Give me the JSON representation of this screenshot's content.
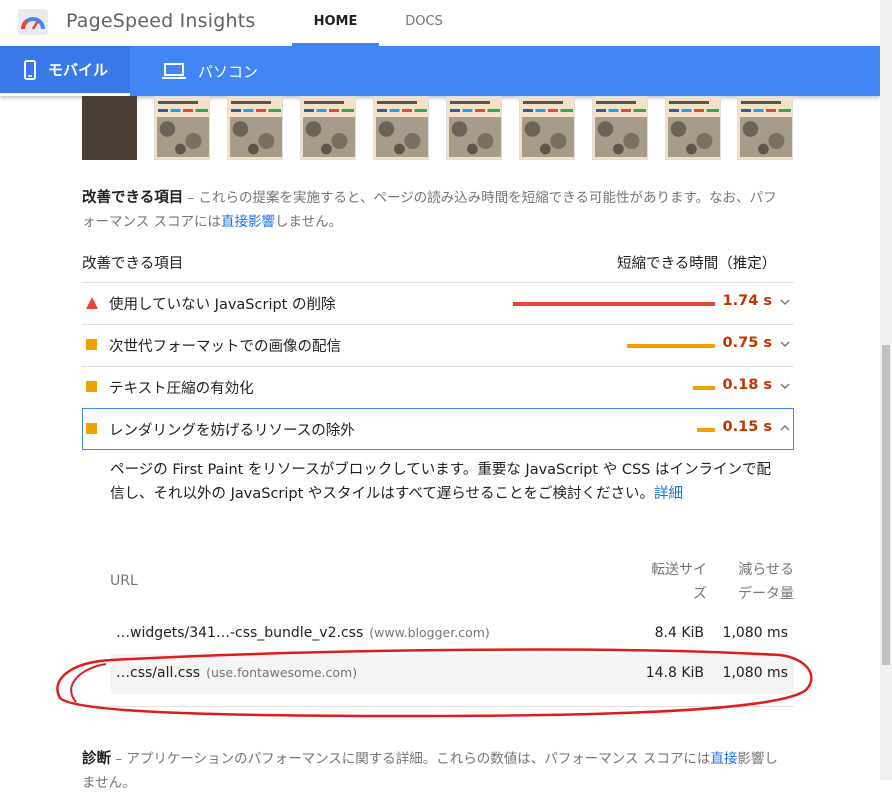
{
  "header": {
    "app_title": "PageSpeed Insights",
    "tab_home": "HOME",
    "tab_docs": "DOCS"
  },
  "devices": {
    "mobile_label": "モバイル",
    "desktop_label": "パソコン"
  },
  "opportunities": {
    "title": "改善できる項目",
    "desc_prefix": "– これらの提案を実施すると、ページの読み込み時間を短縮できる可能性があります。なお、パフォーマンス スコアには",
    "desc_link": "直接影響",
    "desc_suffix": "しません。",
    "col_item": "改善できる項目",
    "col_savings": "短縮できる時間（推定）",
    "items": [
      {
        "label": "使用していない JavaScript の削除",
        "savings": "1.74 s",
        "severity": "fail",
        "bar_fraction": 1.0
      },
      {
        "label": "次世代フォーマットでの画像の配信",
        "savings": "0.75 s",
        "severity": "average",
        "bar_fraction": 0.43
      },
      {
        "label": "テキスト圧縮の有効化",
        "savings": "0.18 s",
        "severity": "average",
        "bar_fraction": 0.1
      },
      {
        "label": "レンダリングを妨げるリソースの除外",
        "savings": "0.15 s",
        "severity": "average",
        "bar_fraction": 0.09
      }
    ],
    "expanded": {
      "description": "ページの First Paint をリソースがブロックしています。重要な JavaScript や CSS はインラインで配信し、それ以外の JavaScript やスタイルはすべて遅らせることをご検討ください。",
      "link": "詳細",
      "col_url": "URL",
      "col_size_1": "転送サイ",
      "col_size_2": "ズ",
      "col_savings_1": "減らせる",
      "col_savings_2": "データ量",
      "rows": [
        {
          "url": "…widgets/341…-css_bundle_v2.css",
          "host": "(www.blogger.com)",
          "size": "8.4 KiB",
          "time": "1,080 ms"
        },
        {
          "url": "…css/all.css",
          "host": "(use.fontawesome.com)",
          "size": "14.8 KiB",
          "time": "1,080 ms"
        }
      ]
    }
  },
  "diagnostics": {
    "title": "診断",
    "desc_prefix": "– アプリケーションのパフォーマンスに関する詳細。これらの数値は、パフォーマンス スコアには",
    "desc_link": "直接",
    "desc_tail": "影響しません。"
  },
  "colors": {
    "brand_blue": "#4285f4",
    "fail": "#eb4335",
    "average": "#f0a300",
    "fail_text": "#c33300",
    "avg_text": "#c33300",
    "annotation": "#e01b1b"
  }
}
